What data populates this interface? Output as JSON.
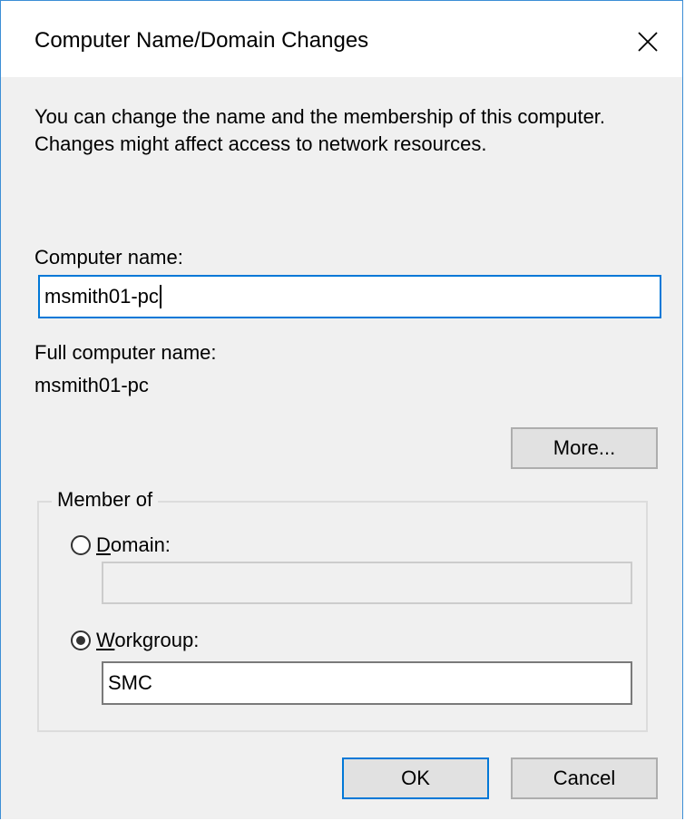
{
  "window": {
    "title": "Computer Name/Domain Changes",
    "close_icon": "close-icon"
  },
  "description": "You can change the name and the membership of this computer. Changes might affect access to network resources.",
  "computer_name": {
    "label": "Computer name:",
    "value": "msmith01-pc"
  },
  "full_name": {
    "label": "Full computer name:",
    "value": "msmith01-pc"
  },
  "more_button": {
    "label": "More..."
  },
  "member_of": {
    "legend": "Member of",
    "domain": {
      "label_first": "D",
      "label_rest": "omain:",
      "value": "",
      "selected": false
    },
    "workgroup": {
      "label_first": "W",
      "label_rest": "orkgroup:",
      "value": "SMC",
      "selected": true
    }
  },
  "footer": {
    "ok_label": "OK",
    "cancel_label": "Cancel"
  },
  "colors": {
    "accent": "#0078d7",
    "window_border": "#3c8ed6",
    "dialog_background": "#f0f0f0"
  }
}
